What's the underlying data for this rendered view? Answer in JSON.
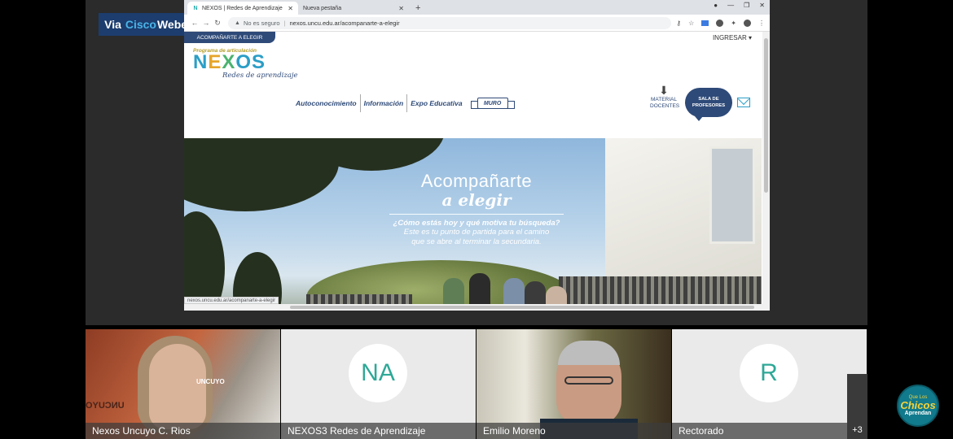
{
  "meeting": {
    "badge_prefix": "Via",
    "badge_cisco": "Cisco",
    "badge_webex": "Webex"
  },
  "browser": {
    "tabs": [
      {
        "title": "NEXOS | Redes de Aprendizaje",
        "active": true
      },
      {
        "title": "Nueva pestaña",
        "active": false
      }
    ],
    "new_tab": "+",
    "security": "No es seguro",
    "url": "nexos.uncu.edu.ar/acompanarte-a-elegir",
    "status_url": "nexos.uncu.edu.ar/acompanarte-a-elegir"
  },
  "site": {
    "top_tab": "ACOMPAÑARTE A ELEGIR",
    "ingresar": "INGRESAR",
    "logo": {
      "tagline": "Programa de articulación",
      "letters": [
        "N",
        "E",
        "X",
        "O",
        "S"
      ],
      "subtitle": "Redes de aprendizaje"
    },
    "nav": [
      "Autoconocimiento",
      "Información",
      "Expo Educativa"
    ],
    "muro": "MURO",
    "material_line1": "MATERIAL",
    "material_line2": "DOCENTES",
    "sala_line1": "SALA DE",
    "sala_line2": "PROFESORES"
  },
  "hero": {
    "title_line1": "Acompañarte",
    "title_line2": "a elegir",
    "question": "¿Cómo estás hoy y qué motiva tu búsqueda?",
    "text_line1": "Este es tu punto de partida para el camino",
    "text_line2": "que se abre al terminar la secundaria."
  },
  "participants": [
    {
      "name": "Nexos Uncuyo C. Rios",
      "type": "video"
    },
    {
      "name": "NEXOS3 Redes de Aprendizaje",
      "type": "avatar",
      "initials": "NA"
    },
    {
      "name": "Emilio Moreno",
      "type": "video"
    },
    {
      "name": "Rectorado",
      "type": "avatar",
      "initials": "R"
    }
  ],
  "more_count": "+3",
  "video_sign": "UNCUYO",
  "brand": {
    "line1": "Que Los",
    "line2": "Chicos",
    "line3": "Aprendan"
  },
  "colors": {
    "nexos_navy": "#2e4a78",
    "nexos_cyan": "#2b9ec6",
    "avatar_teal": "#2ea897",
    "webex_badge": "#1c3d6e"
  }
}
